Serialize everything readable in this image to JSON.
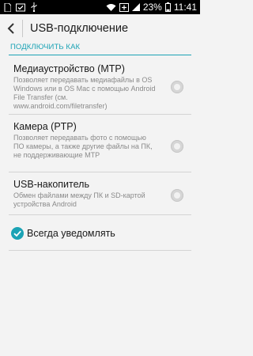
{
  "status_bar": {
    "battery_percent": "23%",
    "time": "11:41",
    "icons": [
      "sim-card-icon",
      "usb-check-icon",
      "usb-icon",
      "wifi-icon",
      "battery-saver-icon",
      "signal-icon",
      "battery-icon"
    ]
  },
  "app_bar": {
    "title": "USB-подключение",
    "back_icon": "chevron-left-icon"
  },
  "section": {
    "header": "ПОДКЛЮЧИТЬ КАК"
  },
  "options": [
    {
      "title": "Медиаустройство (MTP)",
      "description": "Позволяет передавать медиафайлы в OS Windows или в OS Mac с помощью Android File Transfer  (см. www.android.com/filetransfer)",
      "selected": false
    },
    {
      "title": "Камера (PTP)",
      "description": "Позволяет передавать фото с помощью ПО камеры, а также другие файлы на ПК, не поддерживающие МТР",
      "selected": false
    },
    {
      "title": "USB-накопитель",
      "description": "Обмен файлами между ПК и SD-картой устройства Android",
      "selected": false
    }
  ],
  "always_notify": {
    "label": "Всегда уведомлять",
    "checked": true
  },
  "colors": {
    "accent": "#1ba3b5",
    "background": "#f3f3f3",
    "status_bar": "#000000"
  }
}
